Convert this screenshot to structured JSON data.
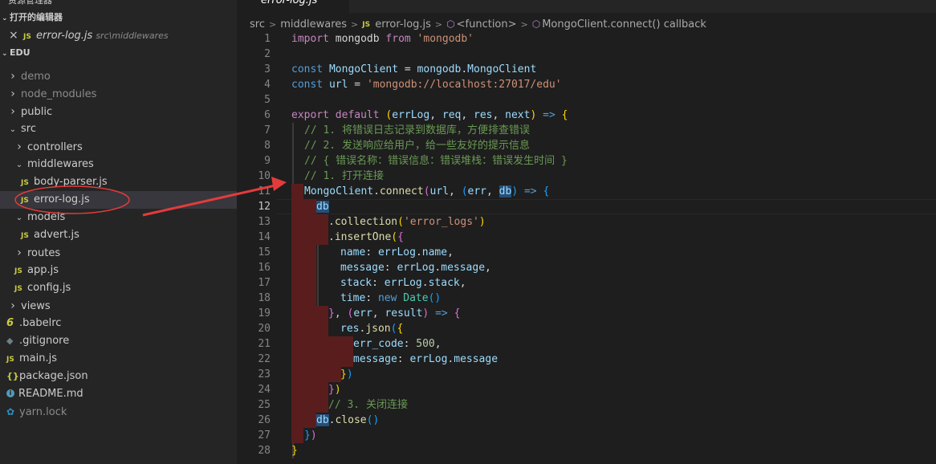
{
  "sidebar": {
    "title": "资源管理器",
    "open_editors_header": "打开的编辑器",
    "open_editor": {
      "name": "error-log.js",
      "path": "src\\middlewares",
      "close_icon": "×",
      "icon": "JS"
    },
    "project_header": "EDU",
    "tree": [
      {
        "label": "demo",
        "kind": "folder",
        "state": "collapsed",
        "dim": true
      },
      {
        "label": "node_modules",
        "kind": "folder",
        "state": "collapsed",
        "dim": true
      },
      {
        "label": "public",
        "kind": "folder",
        "state": "collapsed"
      },
      {
        "label": "src",
        "kind": "folder",
        "state": "expanded"
      },
      {
        "label": "controllers",
        "kind": "folder",
        "state": "collapsed"
      },
      {
        "label": "middlewares",
        "kind": "folder",
        "state": "expanded"
      },
      {
        "label": "body-parser.js",
        "kind": "js"
      },
      {
        "label": "error-log.js",
        "kind": "js",
        "selected": true
      },
      {
        "label": "models",
        "kind": "folder",
        "state": "expanded"
      },
      {
        "label": "advert.js",
        "kind": "js"
      },
      {
        "label": "routes",
        "kind": "folder",
        "state": "collapsed"
      },
      {
        "label": "app.js",
        "kind": "js"
      },
      {
        "label": "config.js",
        "kind": "js"
      },
      {
        "label": "views",
        "kind": "folder",
        "state": "collapsed"
      },
      {
        "label": ".babelrc",
        "kind": "babel"
      },
      {
        "label": ".gitignore",
        "kind": "git"
      },
      {
        "label": "main.js",
        "kind": "js"
      },
      {
        "label": "package.json",
        "kind": "json"
      },
      {
        "label": "README.md",
        "kind": "info"
      },
      {
        "label": "yarn.lock",
        "kind": "yarn",
        "dim": true
      }
    ]
  },
  "editor": {
    "tab_label": "error-log.js",
    "breadcrumb": {
      "seg1": "src",
      "seg2": "middlewares",
      "seg3": "error-log.js",
      "seg4": "<function>",
      "seg5": "MongoClient.connect() callback"
    },
    "active_line": 12,
    "line_numbers": [
      "1",
      "2",
      "3",
      "4",
      "5",
      "6",
      "7",
      "8",
      "9",
      "10",
      "11",
      "12",
      "13",
      "14",
      "15",
      "16",
      "17",
      "18",
      "19",
      "20",
      "21",
      "22",
      "23",
      "24",
      "25",
      "26",
      "27",
      "28"
    ],
    "code": {
      "l1": {
        "a": "import",
        "b": " mongodb ",
        "c": "from",
        "d": " 'mongodb'"
      },
      "l3": {
        "a": "const",
        "b": " MongoClient",
        "c": " = ",
        "d": "mongodb",
        "e": ".",
        "f": "MongoClient"
      },
      "l4": {
        "a": "const",
        "b": " url",
        "c": " = ",
        "d": "'mongodb://localhost:27017/edu'"
      },
      "l6": {
        "a": "export",
        "b": " default ",
        "c": "(",
        "d": "errLog",
        "e": ", ",
        "f": "req",
        "g": ", ",
        "h": "res",
        "i": ", ",
        "j": "next",
        "k": ") ",
        "l": "=>",
        "m": " {"
      },
      "l7": "// 1. 将错误日志记录到数据库，方便排查错误",
      "l8": "// 2. 发送响应给用户，给一些友好的提示信息",
      "l9": "// { 错误名称：错误信息：错误堆栈：错误发生时间 }",
      "l10": "// 1. 打开连接",
      "l11": {
        "a": "MongoClient",
        "b": ".",
        "c": "connect",
        "d": "(",
        "e": "url",
        "f": ", ",
        "g": "(",
        "h": "err",
        "i": ", ",
        "j": "db",
        "k": ")",
        "l": " => ",
        "m": "{"
      },
      "l12": "db",
      "l13": {
        "a": ".",
        "b": "collection",
        "c": "(",
        "d": "'error_logs'",
        "e": ")"
      },
      "l14": {
        "a": ".",
        "b": "insertOne",
        "c": "(",
        "d": "{"
      },
      "l15": {
        "a": "name",
        "b": ": ",
        "c": "errLog",
        "d": ".",
        "e": "name",
        "f": ","
      },
      "l16": {
        "a": "message",
        "b": ": ",
        "c": "errLog",
        "d": ".",
        "e": "message",
        "f": ","
      },
      "l17": {
        "a": "stack",
        "b": ": ",
        "c": "errLog",
        "d": ".",
        "e": "stack",
        "f": ","
      },
      "l18": {
        "a": "time",
        "b": ": ",
        "c": "new",
        "d": " ",
        "e": "Date",
        "f": "()"
      },
      "l19": {
        "a": "}",
        "b": ", ",
        "c": "(",
        "d": "err",
        "e": ", ",
        "f": "result",
        "g": ")",
        "h": " => ",
        "i": "{"
      },
      "l20": {
        "a": "res",
        "b": ".",
        "c": "json",
        "d": "(",
        "e": "{"
      },
      "l21": {
        "a": "err_code",
        "b": ": ",
        "c": "500",
        "d": ","
      },
      "l22": {
        "a": "message",
        "b": ": ",
        "c": "errLog",
        "d": ".",
        "e": "message"
      },
      "l23": {
        "a": "}",
        "b": ")"
      },
      "l24": {
        "a": "}",
        "b": ")"
      },
      "l25": "// 3. 关闭连接",
      "l26": {
        "a": "db",
        "b": ".",
        "c": "close",
        "d": "()"
      },
      "l27": {
        "a": "}",
        "b": ")"
      },
      "l28": "}"
    }
  },
  "colors": {
    "annotation": "#e33b3b",
    "error_block": "#5a1d1d",
    "keyword": "#569cd6",
    "comment": "#6a9955",
    "string": "#ce9178"
  }
}
